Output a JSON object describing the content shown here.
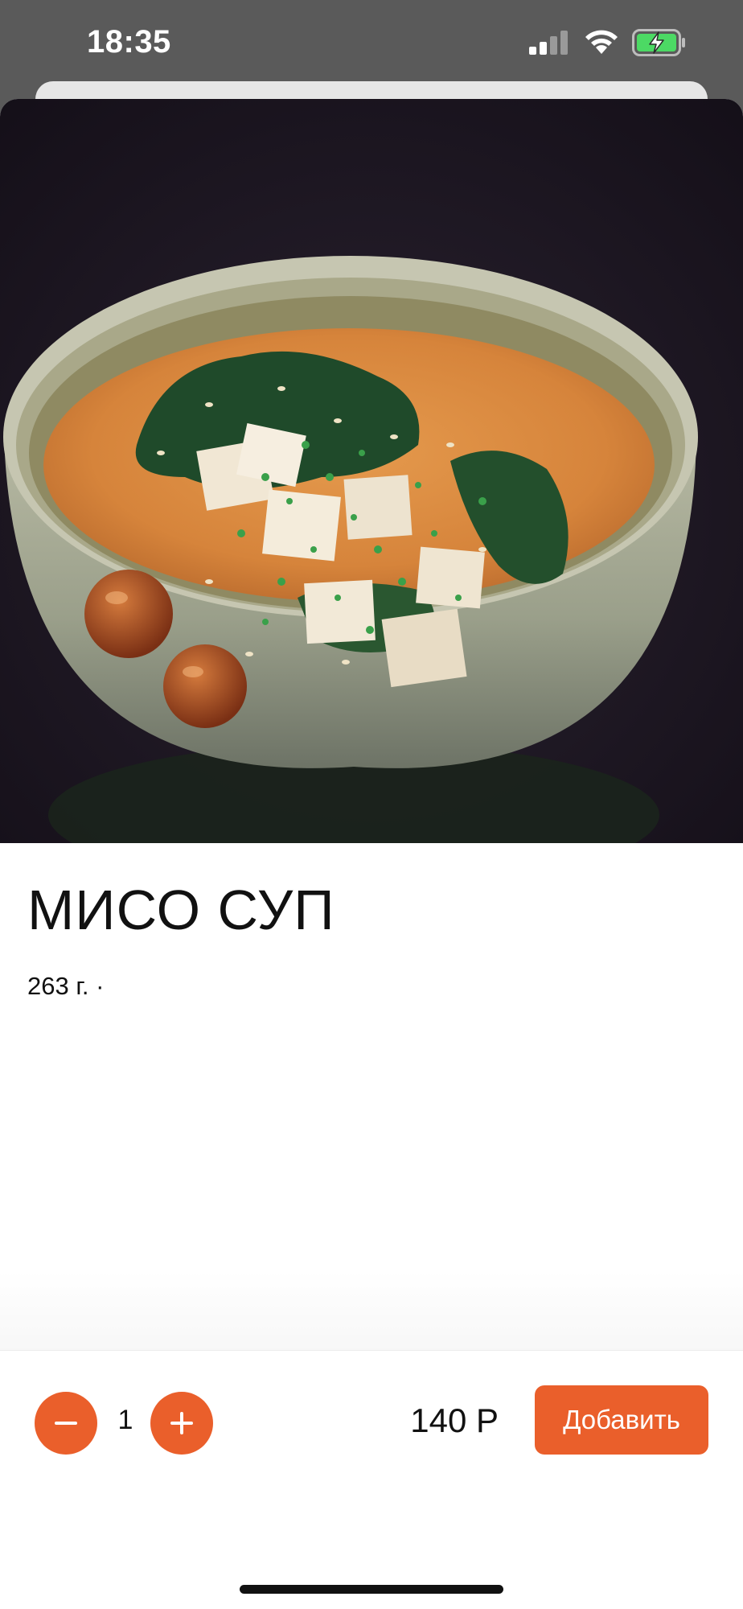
{
  "status_bar": {
    "time": "18:35"
  },
  "product": {
    "title": "МИСО СУП",
    "meta": "263 г. ·",
    "photo_icon": "miso-soup-photo"
  },
  "order": {
    "quantity": "1",
    "price": "140 Р",
    "add_label": "Добавить"
  },
  "colors": {
    "accent": "#ea5f2b",
    "text": "#111111",
    "status_bar_bg": "#5a5a5a",
    "photo_bg": "#1a1422"
  }
}
